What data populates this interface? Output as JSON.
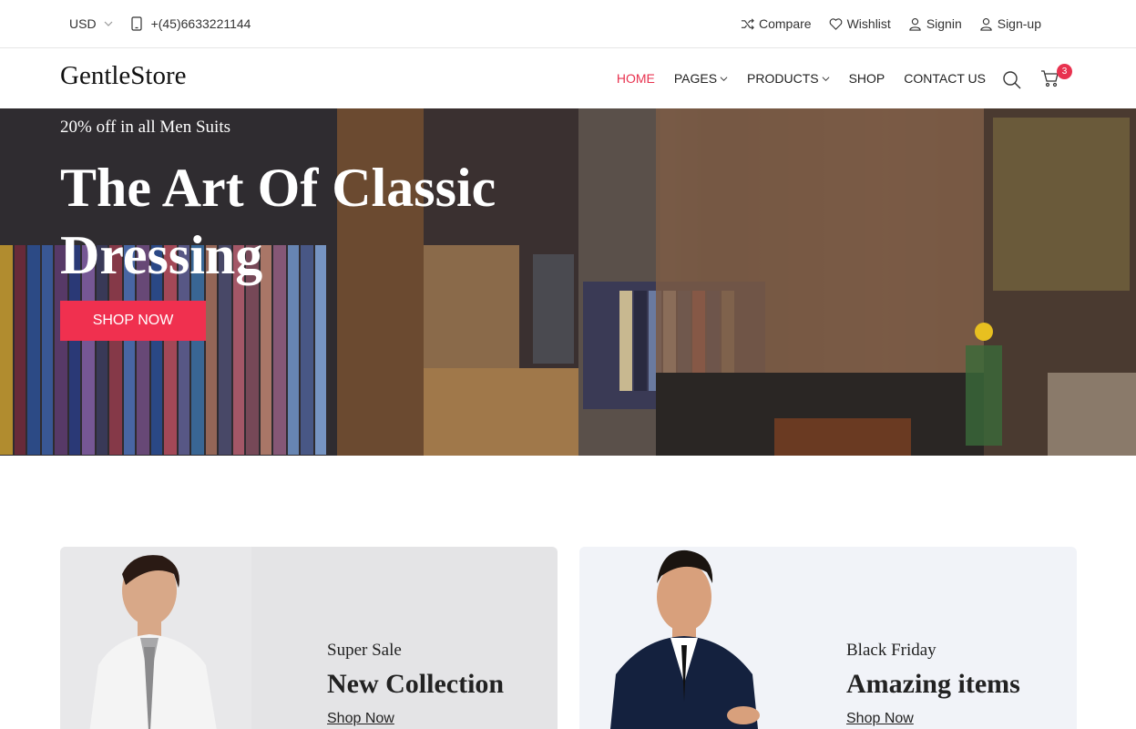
{
  "topbar": {
    "currency": "USD",
    "phone": "+(45)6633221144",
    "links": [
      "Compare",
      "Wishlist",
      "Signin",
      "Sign-up"
    ]
  },
  "header": {
    "logo": "GentleStore",
    "nav": [
      "HOME",
      "PAGES",
      "PRODUCTS",
      "SHOP",
      "CONTACT US"
    ],
    "cart_count": "3"
  },
  "hero": {
    "subtitle": "20% off in all Men Suits",
    "title": "The Art Of Classic Dressing",
    "button": "SHOP NOW"
  },
  "cards": [
    {
      "tag": "Super Sale",
      "heading": "New Collection",
      "link": "Shop Now"
    },
    {
      "tag": "Black Friday",
      "heading": "Amazing items",
      "link": "Shop Now"
    }
  ],
  "colors": {
    "accent": "#f0304f",
    "active_nav": "#e8324f"
  }
}
